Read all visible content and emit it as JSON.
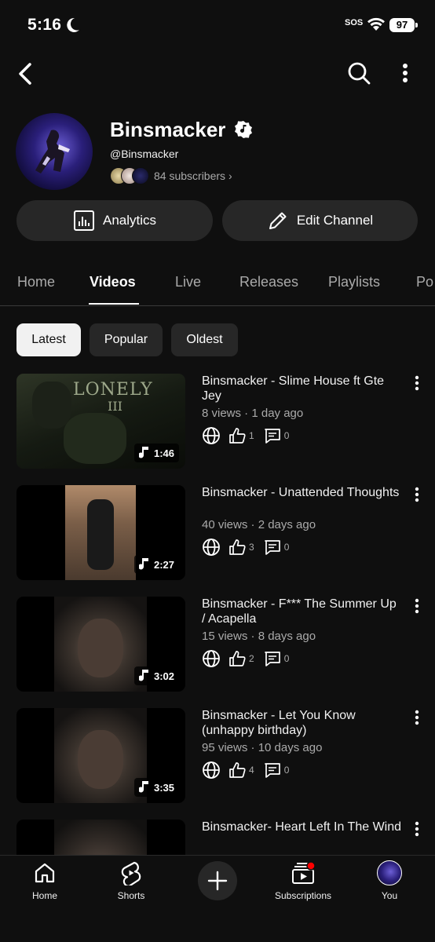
{
  "status_bar": {
    "time": "5:16",
    "sos": "SOS",
    "battery": "97"
  },
  "channel": {
    "name": "Binsmacker",
    "handle": "@Binsmacker",
    "subscribers": "84 subscribers"
  },
  "actions": {
    "analytics": "Analytics",
    "edit": "Edit Channel"
  },
  "tabs": [
    "Home",
    "Videos",
    "Live",
    "Releases",
    "Playlists",
    "Po"
  ],
  "chips": [
    "Latest",
    "Popular",
    "Oldest"
  ],
  "videos": [
    {
      "title": "Binsmacker - Slime House ft Gte Jey",
      "meta": "8 views · 1 day ago",
      "duration": "1:46",
      "likes": "1",
      "comments": "0",
      "thumb_text": "LONELY",
      "thumb_sub": "III"
    },
    {
      "title": "Binsmacker - Unattended Thoughts",
      "meta": "40 views · 2 days ago",
      "duration": "2:27",
      "likes": "3",
      "comments": "0"
    },
    {
      "title": "Binsmacker - F*** The Summer Up / Acapella",
      "meta": "15 views · 8 days ago",
      "duration": "3:02",
      "likes": "2",
      "comments": "0"
    },
    {
      "title": "Binsmacker - Let You Know (unhappy birthday)",
      "meta": "95 views · 10 days ago",
      "duration": "3:35",
      "likes": "4",
      "comments": "0"
    },
    {
      "title": "Binsmacker- Heart Left In The Wind",
      "meta": "",
      "duration": "",
      "likes": "",
      "comments": ""
    }
  ],
  "nav": {
    "home": "Home",
    "shorts": "Shorts",
    "subscriptions": "Subscriptions",
    "you": "You"
  },
  "colors": {
    "background": "#0f0f0f",
    "surface": "#272727",
    "text_secondary": "#aaaaaa",
    "notification": "#ff0000"
  }
}
